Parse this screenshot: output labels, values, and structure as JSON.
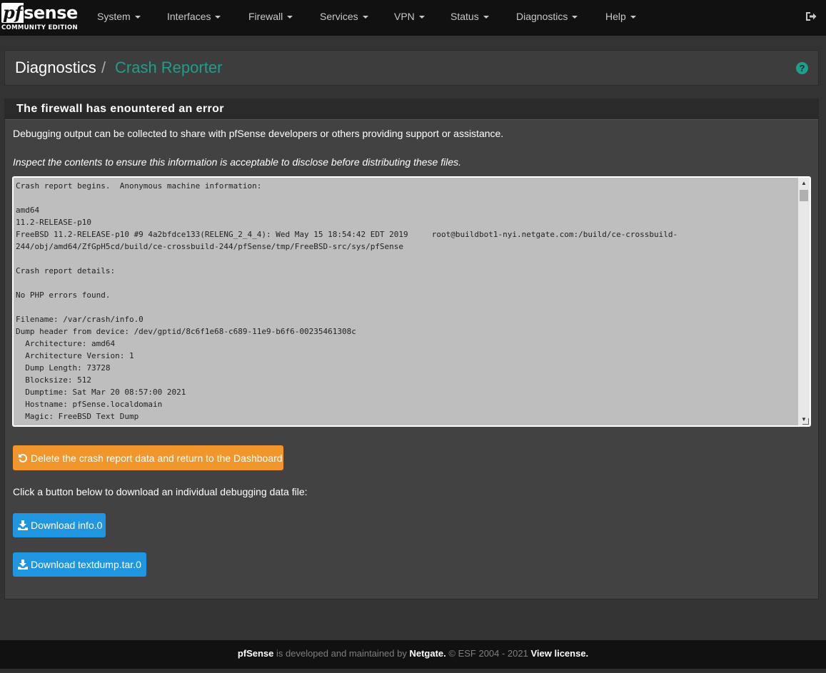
{
  "brand": {
    "logo_pf": "pf",
    "logo_sense": "sense",
    "edition": "COMMUNITY EDITION"
  },
  "nav": {
    "items": [
      {
        "label": "System"
      },
      {
        "label": "Interfaces"
      },
      {
        "label": "Firewall"
      },
      {
        "label": "Services"
      },
      {
        "label": "VPN"
      },
      {
        "label": "Status"
      },
      {
        "label": "Diagnostics"
      },
      {
        "label": "Help"
      }
    ],
    "logout_icon": "sign-out-icon"
  },
  "breadcrumb": {
    "section": "Diagnostics",
    "separator": "/",
    "page": "Crash Reporter",
    "help_icon": "question-circle-icon",
    "help_glyph": "?"
  },
  "panel": {
    "title": "The firewall has enountered an error",
    "intro": "Debugging output can be collected to share with pfSense developers or others providing support or assistance.",
    "warning": "Inspect the contents to ensure this information is acceptable to disclose before distributing these files.",
    "report": "Crash report begins.  Anonymous machine information:\n\namd64\n11.2-RELEASE-p10\nFreeBSD 11.2-RELEASE-p10 #9 4a2bfdce133(RELENG_2_4_4): Wed May 15 18:54:42 EDT 2019     root@buildbot1-nyi.netgate.com:/build/ce-crossbuild-\n244/obj/amd64/ZfGpH5cd/build/ce-crossbuild-244/pfSense/tmp/FreeBSD-src/sys/pfSense\n\nCrash report details:\n\nNo PHP errors found.\n\nFilename: /var/crash/info.0\nDump header from device: /dev/gptid/8c6f1e68-c689-11e9-b6f6-00235461308c\n  Architecture: amd64\n  Architecture Version: 1\n  Dump Length: 73728\n  Blocksize: 512\n  Dumptime: Sat Mar 20 08:57:00 2021\n  Hostname: pfSense.localdomain\n  Magic: FreeBSD Text Dump",
    "delete_button": "Delete the crash report data and return to the Dashboard",
    "download_prompt": "Click a button below to download an individual debugging data file:",
    "download_info": "Download info.0",
    "download_tar": "Download textdump.tar.0"
  },
  "footer": {
    "product": "pfSense",
    "middle": " is developed and maintained by ",
    "company": "Netgate.",
    "copyright": " © ESF 2004 - 2021 ",
    "license": "View license."
  },
  "colors": {
    "accent": "#1f9e8d",
    "orange": "#f0962a",
    "blue": "#2196e0",
    "navbar": "#111111"
  }
}
